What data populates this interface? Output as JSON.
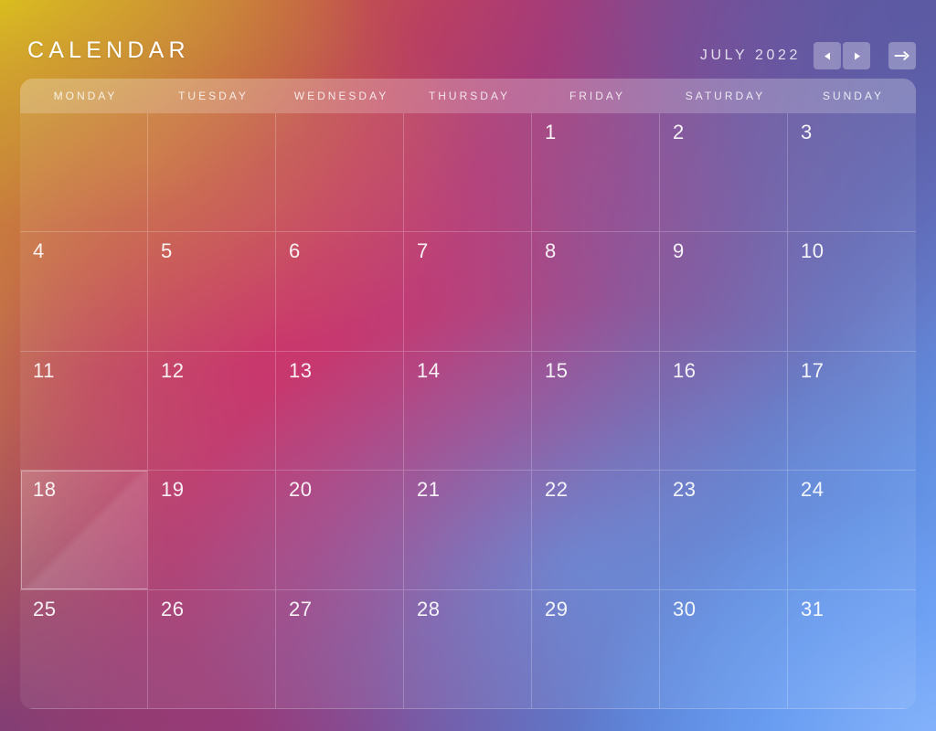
{
  "header": {
    "title": "CALENDAR",
    "month_label": "JULY 2022",
    "prev_button": "◀",
    "next_button": "▶",
    "today_button": "➡"
  },
  "weekdays": [
    "MONDAY",
    "TUESDAY",
    "WEDNESDAY",
    "THURSDAY",
    "FRIDAY",
    "SATURDAY",
    "SUNDAY"
  ],
  "calendar": {
    "month": "JULY",
    "year": "2022",
    "selected_day": "18",
    "leading_blanks": 4,
    "days": [
      {
        "num": "1"
      },
      {
        "num": "2"
      },
      {
        "num": "3"
      },
      {
        "num": "4"
      },
      {
        "num": "5"
      },
      {
        "num": "6"
      },
      {
        "num": "7"
      },
      {
        "num": "8"
      },
      {
        "num": "9"
      },
      {
        "num": "10"
      },
      {
        "num": "11"
      },
      {
        "num": "12"
      },
      {
        "num": "13"
      },
      {
        "num": "14"
      },
      {
        "num": "15"
      },
      {
        "num": "16"
      },
      {
        "num": "17"
      },
      {
        "num": "18"
      },
      {
        "num": "19"
      },
      {
        "num": "20"
      },
      {
        "num": "21"
      },
      {
        "num": "22"
      },
      {
        "num": "23"
      },
      {
        "num": "24"
      },
      {
        "num": "25"
      },
      {
        "num": "26"
      },
      {
        "num": "27"
      },
      {
        "num": "28"
      },
      {
        "num": "29"
      },
      {
        "num": "30"
      },
      {
        "num": "31"
      }
    ]
  },
  "colors": {
    "gradient_top_left": "#d8c522",
    "gradient_mid_left": "#c33a63",
    "gradient_top_right": "#5b5a9e",
    "gradient_bottom_left": "#7a3d78",
    "gradient_bottom_right": "#7fb0f8",
    "text": "#ffffff",
    "panel_overlay": "rgba(255,255,255,0.075)",
    "grid_line": "rgba(255,255,255,0.22)"
  }
}
